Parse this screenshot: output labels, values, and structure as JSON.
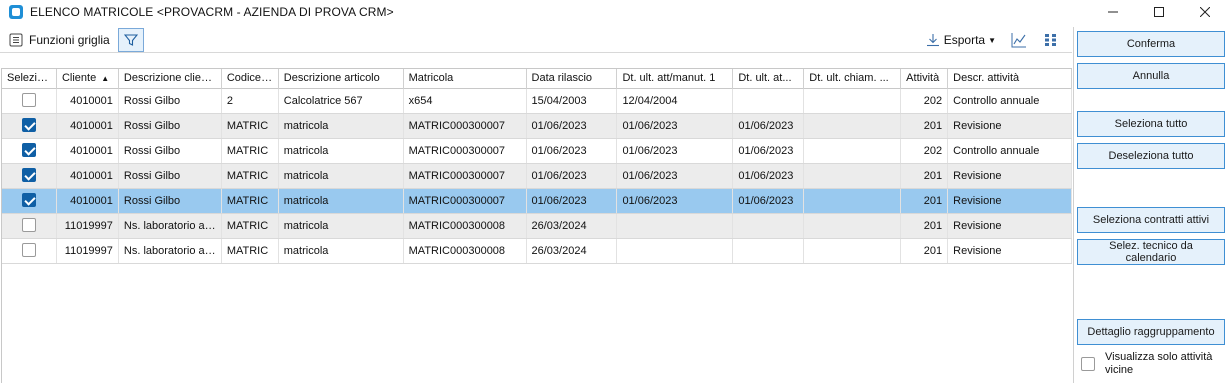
{
  "window": {
    "title": "ELENCO MATRICOLE <PROVACRM - AZIENDA DI PROVA CRM>"
  },
  "toolbar": {
    "funzioni_label": "Funzioni griglia",
    "esporta_label": "Esporta"
  },
  "grid": {
    "columns": [
      "Seleziona",
      "Cliente",
      "Descrizione cliente",
      "Codice ...",
      "Descrizione articolo",
      "Matricola",
      "Data rilascio",
      "Dt. ult. att/manut. 1",
      "Dt. ult. at...",
      "Dt. ult. chiam. ...",
      "Attività",
      "Descr. attività"
    ],
    "sorted_column": "Cliente",
    "rows": [
      {
        "checked": false,
        "cliente": "4010001",
        "desc_cliente": "Rossi Gilbo",
        "codice": "2",
        "desc_articolo": "Calcolatrice 567",
        "matricola": "x654",
        "data_rilascio": "15/04/2003",
        "dt_att1": "12/04/2004",
        "dt_att": "",
        "dt_chiam": "",
        "attivita": "202",
        "descr_attivita": "Controllo annuale"
      },
      {
        "checked": true,
        "cliente": "4010001",
        "desc_cliente": "Rossi Gilbo",
        "codice": "MATRIC",
        "desc_articolo": "matricola",
        "matricola": "MATRIC000300007",
        "data_rilascio": "01/06/2023",
        "dt_att1": "01/06/2023",
        "dt_att": "01/06/2023",
        "dt_chiam": "",
        "attivita": "201",
        "descr_attivita": "Revisione"
      },
      {
        "checked": true,
        "cliente": "4010001",
        "desc_cliente": "Rossi Gilbo",
        "codice": "MATRIC",
        "desc_articolo": "matricola",
        "matricola": "MATRIC000300007",
        "data_rilascio": "01/06/2023",
        "dt_att1": "01/06/2023",
        "dt_att": "01/06/2023",
        "dt_chiam": "",
        "attivita": "202",
        "descr_attivita": "Controllo annuale"
      },
      {
        "checked": true,
        "cliente": "4010001",
        "desc_cliente": "Rossi Gilbo",
        "codice": "MATRIC",
        "desc_articolo": "matricola",
        "matricola": "MATRIC000300007",
        "data_rilascio": "01/06/2023",
        "dt_att1": "01/06/2023",
        "dt_att": "01/06/2023",
        "dt_chiam": "",
        "attivita": "201",
        "descr_attivita": "Revisione"
      },
      {
        "checked": true,
        "cliente": "4010001",
        "desc_cliente": "Rossi Gilbo",
        "codice": "MATRIC",
        "desc_articolo": "matricola",
        "matricola": "MATRIC000300007",
        "data_rilascio": "01/06/2023",
        "dt_att1": "01/06/2023",
        "dt_att": "01/06/2023",
        "dt_chiam": "",
        "attivita": "201",
        "descr_attivita": "Revisione"
      },
      {
        "checked": false,
        "cliente": "11019997",
        "desc_cliente": "Ns. laboratorio as...",
        "codice": "MATRIC",
        "desc_articolo": "matricola",
        "matricola": "MATRIC000300008",
        "data_rilascio": "26/03/2024",
        "dt_att1": "",
        "dt_att": "",
        "dt_chiam": "",
        "attivita": "201",
        "descr_attivita": "Revisione"
      },
      {
        "checked": false,
        "cliente": "11019997",
        "desc_cliente": "Ns. laboratorio as...",
        "codice": "MATRIC",
        "desc_articolo": "matricola",
        "matricola": "MATRIC000300008",
        "data_rilascio": "26/03/2024",
        "dt_att1": "",
        "dt_att": "",
        "dt_chiam": "",
        "attivita": "201",
        "descr_attivita": "Revisione"
      }
    ],
    "selected_row": 4
  },
  "side_panel": {
    "conferma": "Conferma",
    "annulla": "Annulla",
    "seleziona_tutto": "Seleziona tutto",
    "deseleziona_tutto": "Deseleziona tutto",
    "seleziona_contratti": "Seleziona contratti attivi",
    "selez_tecnico": "Selez. tecnico da calendario",
    "dettaglio": "Dettaglio raggruppamento",
    "visualizza_label": "Visualizza solo attività vicine",
    "visualizza_checked": false
  },
  "colors": {
    "accent": "#3f8fd3",
    "checkbox_checked": "#0f5fa5",
    "row_selected": "#99c9ef",
    "row_alt": "#ececec"
  }
}
